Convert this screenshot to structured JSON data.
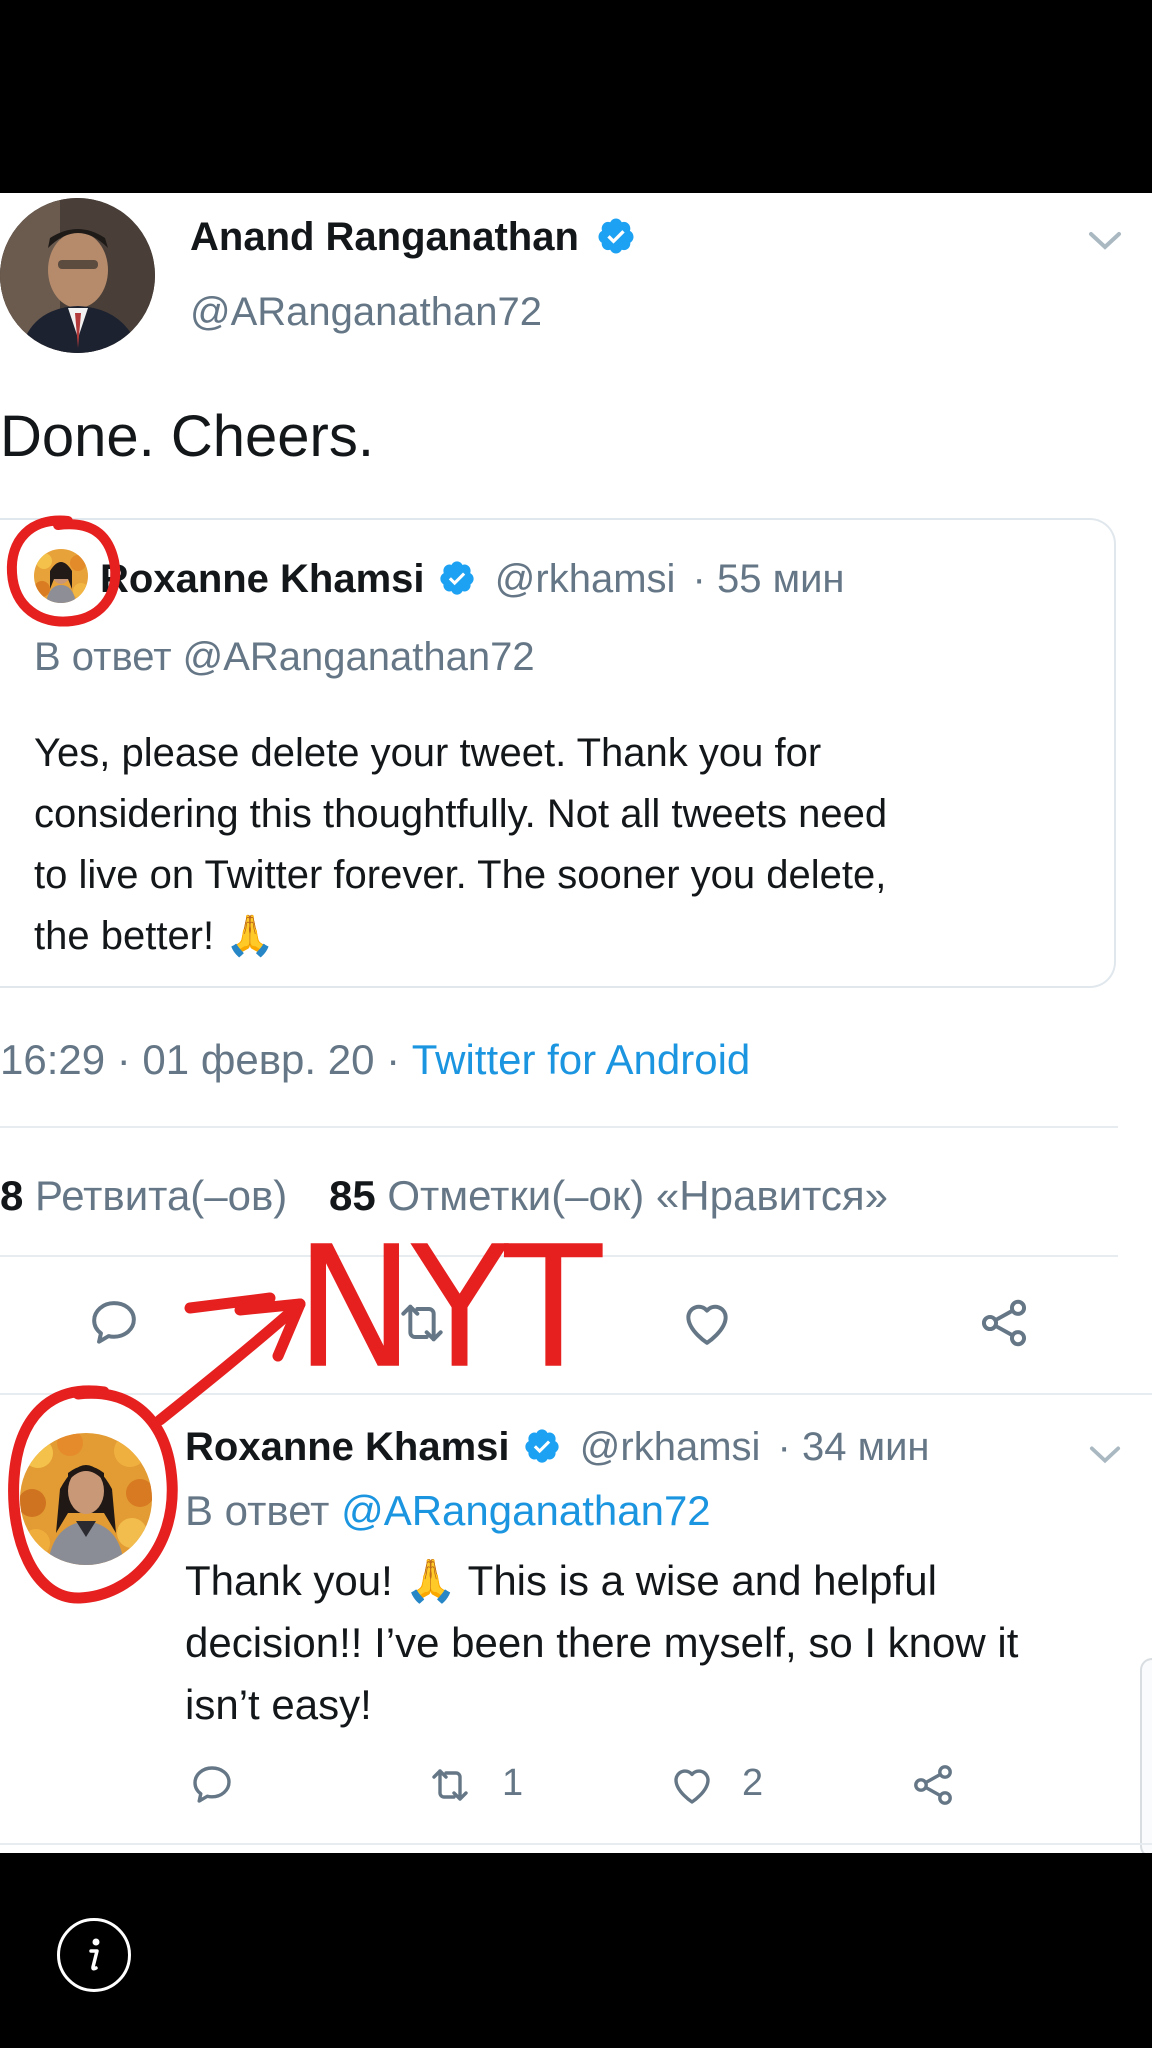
{
  "main_tweet": {
    "author_name": "Anand Ranganathan",
    "author_handle": "@ARanganathan72",
    "text": "Done. Cheers.",
    "timestamp": "16:29 · 01 февр. 20 · ",
    "source": "Twitter for Android",
    "retweet_count": "8",
    "retweet_label": "Ретвита(–ов)",
    "like_count": "85",
    "like_label": "Отметки(–ок) «Нравится»"
  },
  "quoted_tweet": {
    "author_name": "Roxanne Khamsi",
    "author_handle": "@rkhamsi",
    "time": "· 55 мин",
    "reply_to": "В ответ @ARanganathan72",
    "text_lines": [
      "Yes, please delete your tweet. Thank you for",
      "considering this thoughtfully. Not all tweets need",
      "to live on Twitter forever. The sooner you delete,",
      "the better! 🙏"
    ]
  },
  "reply_tweet": {
    "author_name": "Roxanne Khamsi",
    "author_handle": "@rkhamsi",
    "time": "· 34 мин",
    "reply_prefix": "В ответ ",
    "reply_handle": "@ARanganathan72",
    "text_lines": [
      "Thank you! 🙏 This is a wise and helpful",
      "decision!! I’ve been there myself, so I know it",
      "isn’t easy!"
    ],
    "retweet_count": "1",
    "like_count": "2"
  },
  "annotation": {
    "text": "NYT",
    "color": "#e5201f"
  },
  "icons": {
    "verified": "verified-badge-icon",
    "caret": "chevron-down-icon",
    "reply": "reply-icon",
    "retweet": "retweet-icon",
    "like": "heart-icon",
    "share": "share-icon",
    "info": "info-icon"
  },
  "colors": {
    "brand_blue": "#1da1f2",
    "link_blue": "#1b95e0",
    "grey_text": "#657786",
    "annotation_red": "#e5201f"
  }
}
